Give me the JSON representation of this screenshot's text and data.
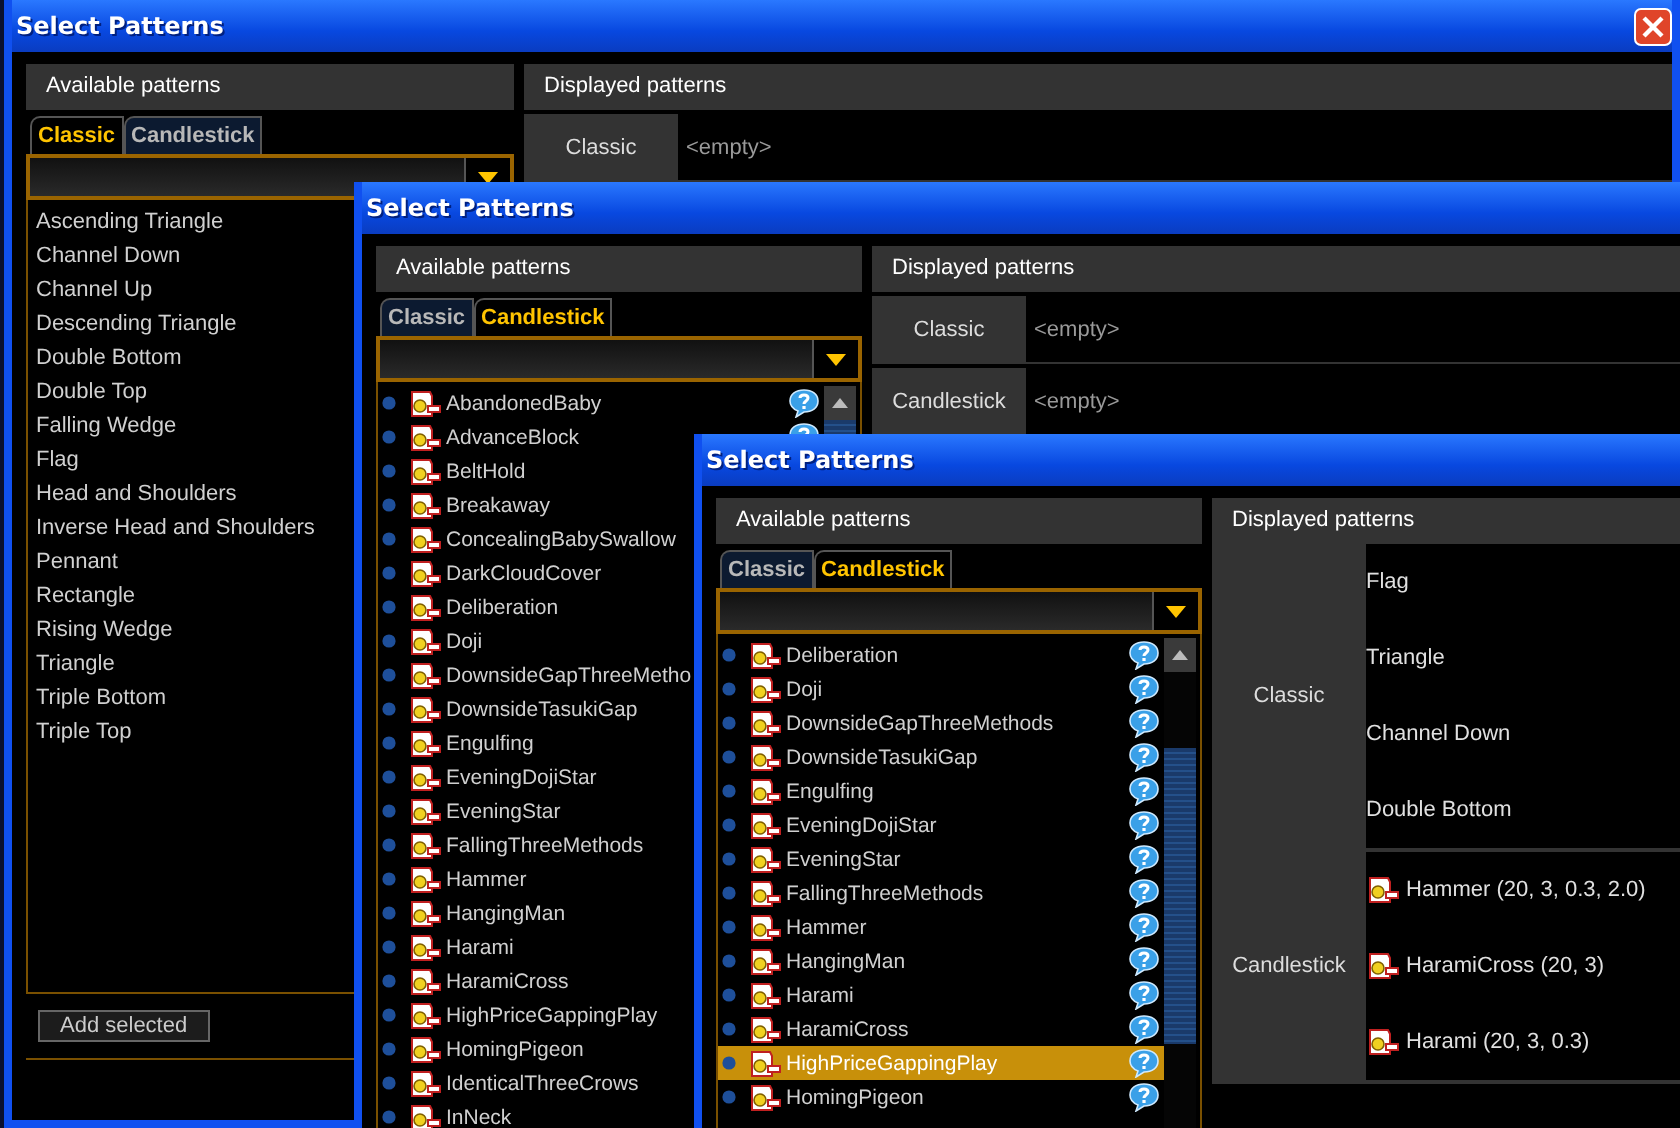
{
  "windows": [
    {
      "title": "Select Patterns",
      "close_button": true,
      "available": {
        "header": "Available patterns",
        "tabs": [
          {
            "label": "Classic",
            "selected": true
          },
          {
            "label": "Candlestick",
            "selected": false
          }
        ],
        "kind": "classic",
        "scrollbar": false,
        "items": [
          {
            "text": "Ascending Triangle",
            "selected": false
          },
          {
            "text": "Channel Down",
            "selected": false
          },
          {
            "text": "Channel Up",
            "selected": false
          },
          {
            "text": "Descending Triangle",
            "selected": false
          },
          {
            "text": "Double Bottom",
            "selected": false
          },
          {
            "text": "Double Top",
            "selected": false
          },
          {
            "text": "Falling Wedge",
            "selected": false
          },
          {
            "text": "Flag",
            "selected": false
          },
          {
            "text": "Head and Shoulders",
            "selected": false
          },
          {
            "text": "Inverse Head and Shoulders",
            "selected": false
          },
          {
            "text": "Pennant",
            "selected": false
          },
          {
            "text": "Rectangle",
            "selected": false
          },
          {
            "text": "Rising Wedge",
            "selected": false
          },
          {
            "text": "Triangle",
            "selected": false
          },
          {
            "text": "Triple Bottom",
            "selected": false
          },
          {
            "text": "Triple Top",
            "selected": false
          }
        ],
        "add_button": "Add selected"
      },
      "displayed": {
        "header": "Displayed patterns",
        "groups": [
          {
            "name": "Classic",
            "empty_text": "<empty>"
          }
        ]
      }
    },
    {
      "title": "Select Patterns",
      "close_button": false,
      "available": {
        "header": "Available patterns",
        "tabs": [
          {
            "label": "Classic",
            "selected": false
          },
          {
            "label": "Candlestick",
            "selected": true
          }
        ],
        "kind": "candlestick",
        "scrollbar": true,
        "items": [
          {
            "text": "AbandonedBaby",
            "selected": false,
            "help": true
          },
          {
            "text": "AdvanceBlock",
            "selected": false,
            "help": true
          },
          {
            "text": "BeltHold",
            "selected": false,
            "help": false
          },
          {
            "text": "Breakaway",
            "selected": false,
            "help": false
          },
          {
            "text": "ConcealingBabySwallow",
            "selected": false,
            "help": false
          },
          {
            "text": "DarkCloudCover",
            "selected": false,
            "help": false
          },
          {
            "text": "Deliberation",
            "selected": false,
            "help": false
          },
          {
            "text": "Doji",
            "selected": false,
            "help": false
          },
          {
            "text": "DownsideGapThreeMetho",
            "selected": false,
            "help": false
          },
          {
            "text": "DownsideTasukiGap",
            "selected": false,
            "help": false
          },
          {
            "text": "Engulfing",
            "selected": false,
            "help": false
          },
          {
            "text": "EveningDojiStar",
            "selected": false,
            "help": false
          },
          {
            "text": "EveningStar",
            "selected": false,
            "help": false
          },
          {
            "text": "FallingThreeMethods",
            "selected": false,
            "help": false
          },
          {
            "text": "Hammer",
            "selected": false,
            "help": false
          },
          {
            "text": "HangingMan",
            "selected": false,
            "help": false
          },
          {
            "text": "Harami",
            "selected": false,
            "help": false
          },
          {
            "text": "HaramiCross",
            "selected": false,
            "help": false
          },
          {
            "text": "HighPriceGappingPlay",
            "selected": false,
            "help": false
          },
          {
            "text": "HomingPigeon",
            "selected": false,
            "help": false
          },
          {
            "text": "IdenticalThreeCrows",
            "selected": false,
            "help": false
          },
          {
            "text": "InNeck",
            "selected": false,
            "help": false
          }
        ]
      },
      "displayed": {
        "header": "Displayed patterns",
        "groups": [
          {
            "name": "Classic",
            "empty_text": "<empty>"
          },
          {
            "name": "Candlestick",
            "empty_text": "<empty>"
          }
        ]
      }
    },
    {
      "title": "Select Patterns",
      "close_button": false,
      "available": {
        "header": "Available patterns",
        "tabs": [
          {
            "label": "Classic",
            "selected": false
          },
          {
            "label": "Candlestick",
            "selected": true
          }
        ],
        "kind": "candlestick",
        "scrollbar": true,
        "items": [
          {
            "text": "Deliberation",
            "selected": false,
            "help": true
          },
          {
            "text": "Doji",
            "selected": false,
            "help": true
          },
          {
            "text": "DownsideGapThreeMethods",
            "selected": false,
            "help": true
          },
          {
            "text": "DownsideTasukiGap",
            "selected": false,
            "help": true
          },
          {
            "text": "Engulfing",
            "selected": false,
            "help": true
          },
          {
            "text": "EveningDojiStar",
            "selected": false,
            "help": true
          },
          {
            "text": "EveningStar",
            "selected": false,
            "help": true
          },
          {
            "text": "FallingThreeMethods",
            "selected": false,
            "help": true
          },
          {
            "text": "Hammer",
            "selected": false,
            "help": true
          },
          {
            "text": "HangingMan",
            "selected": false,
            "help": true
          },
          {
            "text": "Harami",
            "selected": false,
            "help": true
          },
          {
            "text": "HaramiCross",
            "selected": false,
            "help": true
          },
          {
            "text": "HighPriceGappingPlay",
            "selected": true,
            "help": true
          },
          {
            "text": "HomingPigeon",
            "selected": false,
            "help": true
          }
        ]
      },
      "displayed": {
        "header": "Displayed patterns",
        "groups": [
          {
            "name": "Classic",
            "kind": "classic",
            "items": [
              "Flag",
              "Triangle",
              "Channel Down",
              "Double Bottom"
            ]
          },
          {
            "name": "Candlestick",
            "kind": "candlestick",
            "items": [
              "Hammer (20, 3, 0.3, 2.0)",
              "HaramiCross (20, 3)",
              "Harami (20, 3, 0.3)"
            ]
          }
        ]
      }
    }
  ]
}
